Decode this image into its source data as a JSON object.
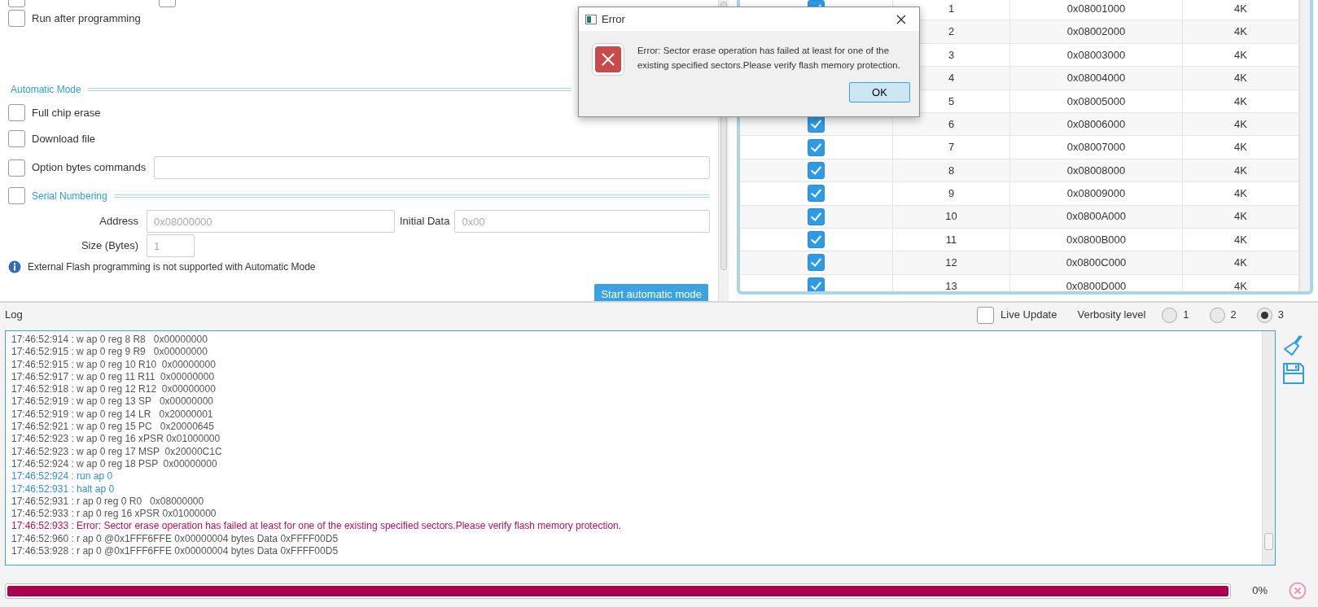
{
  "programming_options": {
    "cut_checkboxes": [
      {
        "checked": false
      },
      {
        "checked": false
      }
    ],
    "run_after_programming": {
      "label": "Run after programming",
      "checked": false
    }
  },
  "automatic_mode": {
    "title": "Automatic Mode",
    "options": [
      {
        "label": "Full chip erase",
        "checked": false
      },
      {
        "label": "Download file",
        "checked": false
      },
      {
        "label": "Option bytes commands",
        "checked": false,
        "has_field": true
      }
    ],
    "serial_numbering": {
      "label": "Serial Numbering",
      "checked": false,
      "address_label": "Address",
      "address_placeholder": "0x08000000",
      "initial_data_label": "Initial Data",
      "initial_data_placeholder": "0x00",
      "size_label": "Size (Bytes)",
      "size_placeholder": "1"
    },
    "info": "External Flash programming is not supported with Automatic Mode",
    "start_button": "Start automatic mode"
  },
  "sectors": [
    {
      "index": "1",
      "address": "0x08001000",
      "size": "4K",
      "checked": true
    },
    {
      "index": "2",
      "address": "0x08002000",
      "size": "4K"
    },
    {
      "index": "3",
      "address": "0x08003000",
      "size": "4K"
    },
    {
      "index": "4",
      "address": "0x08004000",
      "size": "4K"
    },
    {
      "index": "5",
      "address": "0x08005000",
      "size": "4K"
    },
    {
      "index": "6",
      "address": "0x08006000",
      "size": "4K",
      "checked": true
    },
    {
      "index": "7",
      "address": "0x08007000",
      "size": "4K",
      "checked": true
    },
    {
      "index": "8",
      "address": "0x08008000",
      "size": "4K",
      "checked": true
    },
    {
      "index": "9",
      "address": "0x08009000",
      "size": "4K",
      "checked": true
    },
    {
      "index": "10",
      "address": "0x0800A000",
      "size": "4K",
      "checked": true
    },
    {
      "index": "11",
      "address": "0x0800B000",
      "size": "4K",
      "checked": true
    },
    {
      "index": "12",
      "address": "0x0800C000",
      "size": "4K",
      "checked": true
    },
    {
      "index": "13",
      "address": "0x0800D000",
      "size": "4K",
      "checked": true
    }
  ],
  "dialog": {
    "title": "Error",
    "message": "Error: Sector erase operation has failed at least for one of the existing specified sectors.Please verify flash memory protection.",
    "button": "OK"
  },
  "log": {
    "title": "Log",
    "live_update": {
      "label": "Live Update",
      "checked": false
    },
    "verbosity_label": "Verbosity level",
    "verbosity": [
      {
        "label": "1",
        "selected": false
      },
      {
        "label": "2",
        "selected": false
      },
      {
        "label": "3",
        "selected": true
      }
    ],
    "lines": [
      {
        "kind": "normal",
        "text": "17:46:52:914 : w ap 0 reg 8 R8   0x00000000"
      },
      {
        "kind": "normal",
        "text": "17:46:52:915 : w ap 0 reg 9 R9   0x00000000"
      },
      {
        "kind": "normal",
        "text": "17:46:52:915 : w ap 0 reg 10 R10  0x00000000"
      },
      {
        "kind": "normal",
        "text": "17:46:52:917 : w ap 0 reg 11 R11  0x00000000"
      },
      {
        "kind": "normal",
        "text": "17:46:52:918 : w ap 0 reg 12 R12  0x00000000"
      },
      {
        "kind": "normal",
        "text": "17:46:52:919 : w ap 0 reg 13 SP   0x00000000"
      },
      {
        "kind": "normal",
        "text": "17:46:52:919 : w ap 0 reg 14 LR   0x20000001"
      },
      {
        "kind": "normal",
        "text": "17:46:52:921 : w ap 0 reg 15 PC   0x20000645"
      },
      {
        "kind": "normal",
        "text": "17:46:52:923 : w ap 0 reg 16 xPSR 0x01000000"
      },
      {
        "kind": "normal",
        "text": "17:46:52:923 : w ap 0 reg 17 MSP  0x20000C1C"
      },
      {
        "kind": "normal",
        "text": "17:46:52:924 : w ap 0 reg 18 PSP  0x00000000"
      },
      {
        "kind": "command",
        "text": "17:46:52:924 : run ap 0"
      },
      {
        "kind": "command",
        "text": "17:46:52:931 : halt ap 0"
      },
      {
        "kind": "normal",
        "text": "17:46:52:931 : r ap 0 reg 0 R0   0x08000000"
      },
      {
        "kind": "normal",
        "text": "17:46:52:933 : r ap 0 reg 16 xPSR 0x01000000"
      },
      {
        "kind": "error",
        "text": "17:46:52:933 : Error: Sector erase operation has failed at least for one of the existing specified sectors.Please verify flash memory protection."
      },
      {
        "kind": "normal",
        "text": "17:46:52:960 : r ap 0 @0x1FFF6FFE 0x00000004 bytes Data 0xFFFF00D5"
      },
      {
        "kind": "normal",
        "text": "17:46:53:928 : r ap 0 @0x1FFF6FFE 0x00000004 bytes Data 0xFFFF00D5"
      }
    ]
  },
  "progress": {
    "level": 1,
    "reading": "0%"
  }
}
